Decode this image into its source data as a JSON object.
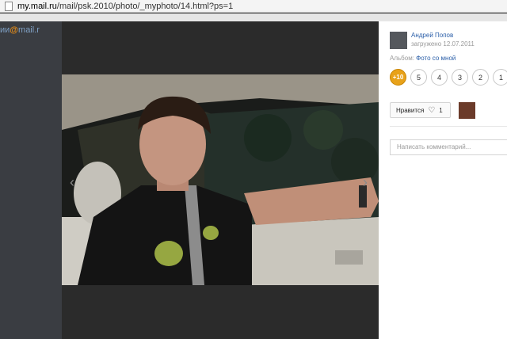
{
  "address_bar": {
    "url_host": "my.mail.ru",
    "url_path": "/mail/psk.2010/photo/_myphoto/14.html?ps=1"
  },
  "background": {
    "logo_text_left": "ии",
    "logo_at": "@",
    "logo_text_right": "mail.r"
  },
  "photo": {
    "alt": "Man in a car"
  },
  "sidebar": {
    "author_name": "Андрей Попов",
    "uploaded": "загружено 12.07.2011",
    "album_label": "Альбом:",
    "album_name": "Фото со мной",
    "ratings": [
      "+10",
      "5",
      "4",
      "3",
      "2",
      "1"
    ],
    "like_label": "Нравится",
    "like_count": "1",
    "comment_placeholder": "Написать комментарий..."
  },
  "colors": {
    "accent": "#e8a21a",
    "link": "#2a5ea8",
    "dim_bg": "#2b2b2b"
  }
}
